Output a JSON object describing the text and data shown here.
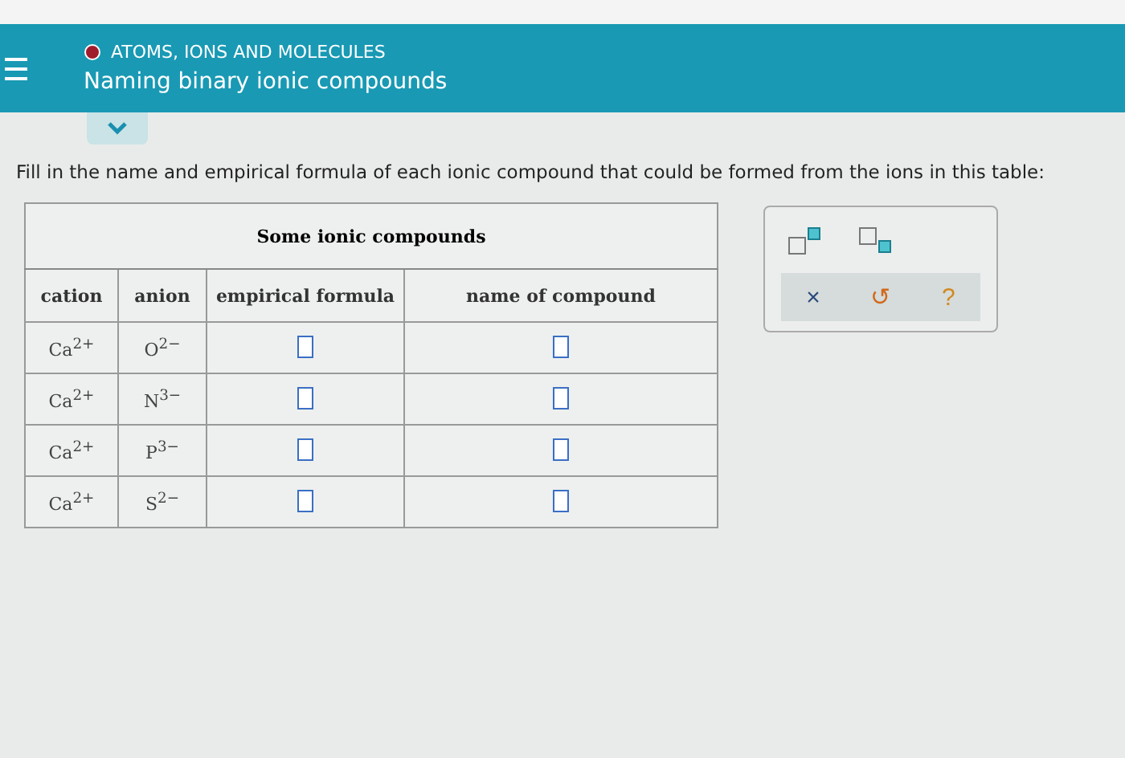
{
  "header": {
    "topic": "ATOMS, IONS AND MOLECULES",
    "title": "Naming binary ionic compounds"
  },
  "instruction": "Fill in the name and empirical formula of each ionic compound that could be formed from the ions in this table:",
  "table": {
    "caption": "Some ionic compounds",
    "columns": [
      "cation",
      "anion",
      "empirical formula",
      "name of compound"
    ],
    "rows": [
      {
        "cation": "Ca$^{2+}$",
        "anion": "O$^{2−}$"
      },
      {
        "cation": "Ca$^{2+}$",
        "anion": "N$^{3−}$"
      },
      {
        "cation": "Ca$^{2+}$",
        "anion": "P$^{3−}$"
      },
      {
        "cation": "Ca$^{2+}$",
        "anion": "S$^{2−}$"
      }
    ]
  },
  "tools": {
    "actions": [
      {
        "kind": "clear",
        "label": "×"
      },
      {
        "kind": "undo",
        "label": "↺"
      },
      {
        "kind": "help",
        "label": "?"
      }
    ]
  }
}
